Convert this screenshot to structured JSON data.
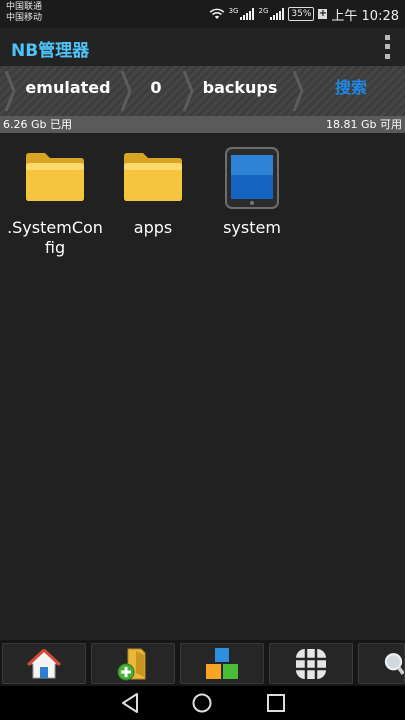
{
  "status_bar": {
    "carrier_1": "中国联通",
    "carrier_2": "中国移动",
    "signal_1_tag": "3G",
    "signal_2_tag": "2G",
    "battery": "35%",
    "time": "上午 10:28"
  },
  "app": {
    "title": "NB管理器",
    "menu_icon": "overflow-menu-icon"
  },
  "breadcrumb": {
    "items": [
      "emulated",
      "0",
      "backups"
    ],
    "search_label": "搜索"
  },
  "storage": {
    "used": "6.26 Gb 已用",
    "free": "18.81 Gb 可用"
  },
  "files": [
    {
      "name": ".SystemConfig",
      "icon": "folder-icon"
    },
    {
      "name": "apps",
      "icon": "folder-icon"
    },
    {
      "name": "system",
      "icon": "tablet-icon"
    }
  ],
  "toolbar": {
    "buttons": [
      "home-icon",
      "add-folder-icon",
      "apps-blocks-icon",
      "grid-view-icon",
      "search-icon"
    ]
  },
  "colors": {
    "accent": "#4fc3f7",
    "search_link": "#1e88e5",
    "background": "#212121",
    "folder": "#f3c13a"
  }
}
